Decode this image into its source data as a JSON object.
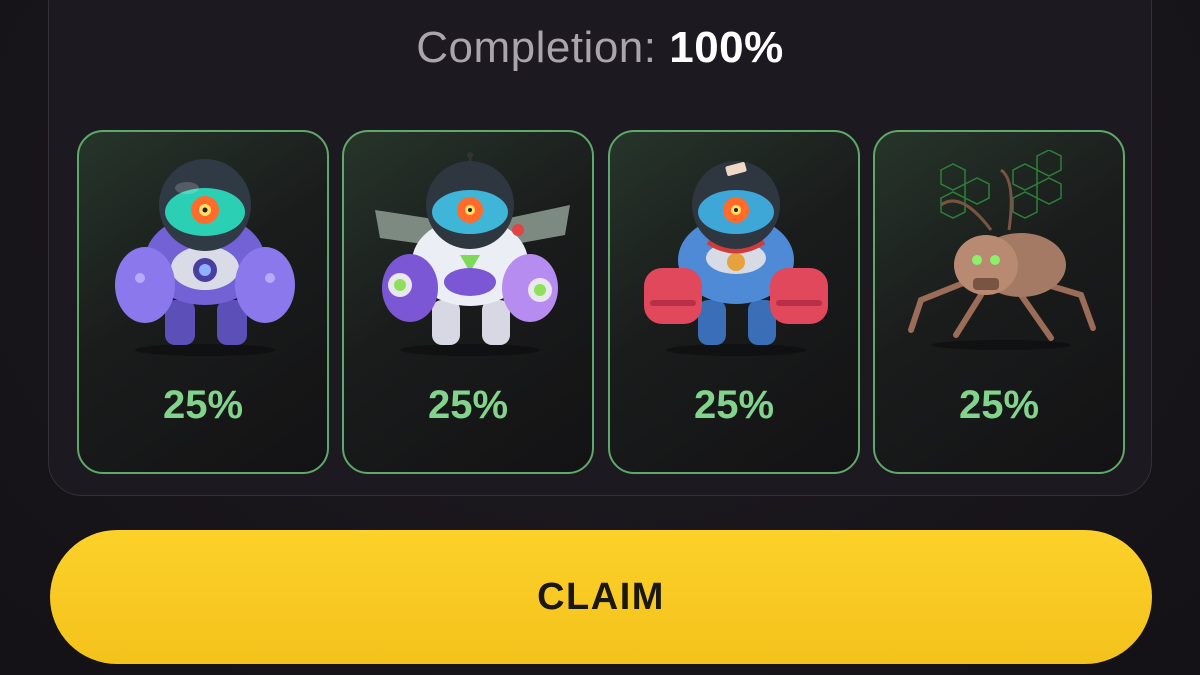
{
  "completion": {
    "label": "Completion:",
    "value": "100%"
  },
  "cards": [
    {
      "name": "purple-mech-character",
      "icon": "purple-robot-icon",
      "percent": "25%"
    },
    {
      "name": "white-purple-winged-mech-character",
      "icon": "winged-robot-icon",
      "percent": "25%"
    },
    {
      "name": "blue-red-mech-character",
      "icon": "red-blue-robot-icon",
      "percent": "25%"
    },
    {
      "name": "insect-bug-character",
      "icon": "bug-icon",
      "percent": "25%"
    }
  ],
  "claim": {
    "label": "CLAIM"
  },
  "colors": {
    "accent_green": "#82d38c",
    "card_border": "#5ea869",
    "claim_yellow": "#fcd12a",
    "background": "#18151b"
  }
}
